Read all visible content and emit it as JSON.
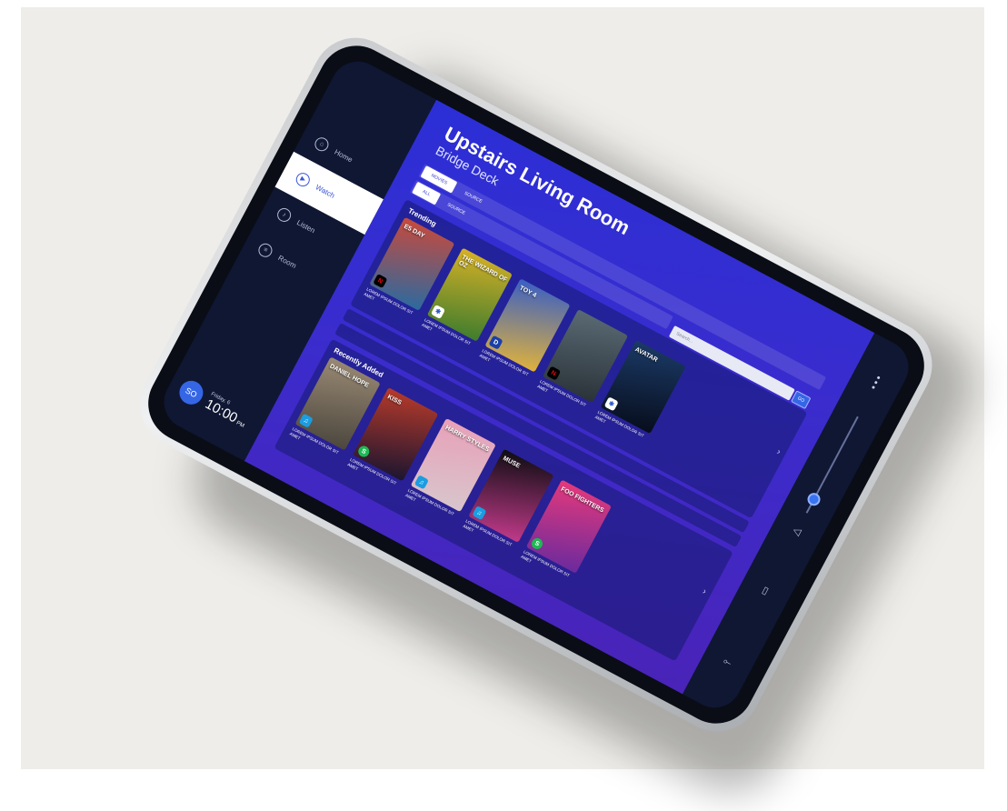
{
  "sidebar": {
    "items": [
      {
        "label": "Home",
        "icon": "home-icon",
        "glyph": "⌂"
      },
      {
        "label": "Watch",
        "icon": "play-icon",
        "glyph": "▶"
      },
      {
        "label": "Listen",
        "icon": "music-icon",
        "glyph": "♪"
      },
      {
        "label": "Room",
        "icon": "equalizer-icon",
        "glyph": "≡"
      }
    ],
    "active_index": 1,
    "user_initials": "SO",
    "day": "Friday, 6",
    "time": "10:00",
    "ampm": "PM"
  },
  "header": {
    "title": "Upstairs Living Room",
    "subtitle": "Bridge Deck"
  },
  "tabs_primary": [
    {
      "label": "MOVIES",
      "active": true
    },
    {
      "label": "SOURCE",
      "active": false
    }
  ],
  "tabs_secondary": [
    {
      "label": "ALL",
      "active": true
    },
    {
      "label": "SOURCE",
      "active": false
    }
  ],
  "search": {
    "placeholder": "Search...",
    "button_label": "GO"
  },
  "trending": {
    "title": "Trending",
    "items": [
      {
        "title": "E5 DAY",
        "caption": "LOREM IPSUM DOLOR SIT AMET",
        "source": "N",
        "colors": [
          "#c9493b",
          "#2b6aa0"
        ]
      },
      {
        "title": "THE WIZARD OF OZ",
        "caption": "LOREM IPSUM DOLOR SIT AMET",
        "source": "✱",
        "colors": [
          "#d7b126",
          "#3e7c2e"
        ]
      },
      {
        "title": "TOY 4",
        "caption": "LOREM IPSUM DOLOR SIT AMET",
        "source": "D",
        "colors": [
          "#3a5fc4",
          "#e0b23c"
        ]
      },
      {
        "title": "",
        "caption": "LOREM IPSUM DOLOR SIT AMET",
        "source": "N",
        "colors": [
          "#5a6a74",
          "#2a3238"
        ]
      },
      {
        "title": "AVATAR",
        "caption": "LOREM IPSUM DOLOR SIT AMET",
        "source": "✱",
        "colors": [
          "#1b3a66",
          "#070d1c"
        ]
      }
    ]
  },
  "recent": {
    "title": "Recently Added",
    "items": [
      {
        "title": "DANIEL HOPE",
        "caption": "LOREM IPSUM DOLOR SIT AMET",
        "source": "♫",
        "colors": [
          "#9a8a74",
          "#4b463e"
        ]
      },
      {
        "title": "KISS",
        "caption": "LOREM IPSUM DOLOR SIT AMET",
        "source": "S",
        "colors": [
          "#b73a2a",
          "#1b1530"
        ]
      },
      {
        "title": "HARRY STYLES",
        "caption": "LOREM IPSUM DOLOR SIT AMET",
        "source": "♫",
        "colors": [
          "#e8a0b8",
          "#d8c6cc"
        ]
      },
      {
        "title": "MUSE",
        "caption": "LOREM IPSUM DOLOR SIT AMET",
        "source": "♫",
        "colors": [
          "#0d0d12",
          "#c23a8a"
        ]
      },
      {
        "title": "FOO FIGHTERS",
        "caption": "LOREM IPSUM DOLOR SIT AMET",
        "source": "S",
        "colors": [
          "#e6397a",
          "#6a2a9e"
        ]
      }
    ]
  },
  "right_panel": {
    "menu_icon": "more-vertical-icon",
    "volume_level": 0.75,
    "speaker_icon": "speaker-icon",
    "remote_icon": "remote-icon",
    "share_icon": "share-icon"
  },
  "colors": {
    "accent": "#3566e6",
    "main_gradient_start": "#2b2fd6",
    "main_gradient_end": "#4a23b8",
    "sidebar_bg": "#0f1733"
  }
}
